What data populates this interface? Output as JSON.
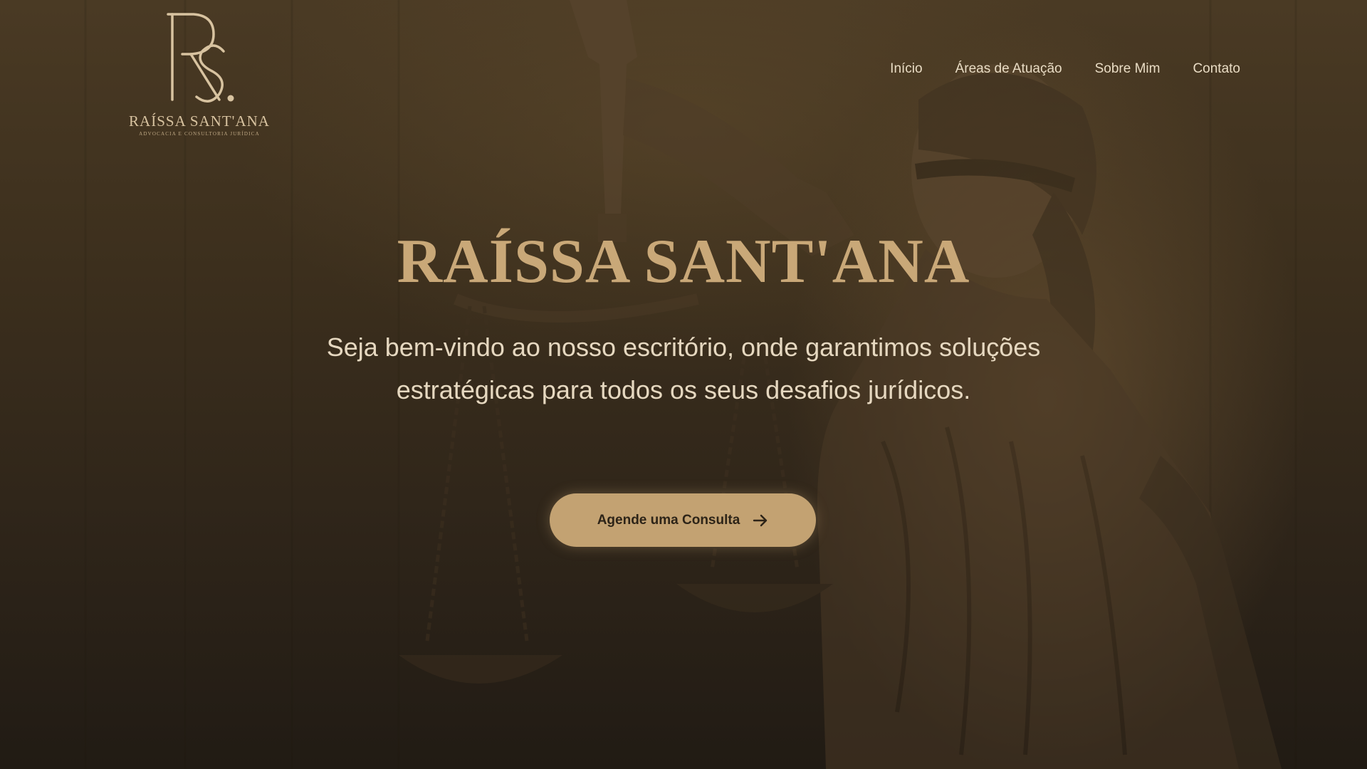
{
  "brand": {
    "logo_monogram": "RS.",
    "name": "RAÍSSA SANT'ANA",
    "tagline": "ADVOCACIA E CONSULTORIA JURÍDICA"
  },
  "nav": {
    "items": [
      {
        "label": "Início"
      },
      {
        "label": "Áreas de Atuação"
      },
      {
        "label": "Sobre Mim"
      },
      {
        "label": "Contato"
      }
    ]
  },
  "hero": {
    "title": "RAÍSSA SANT'ANA",
    "subtitle": "Seja bem-vindo ao nosso escritório, onde garantimos soluções estratégicas para todos os seus desafios jurídicos.",
    "cta_label": "Agende uma Consulta",
    "cta_icon": "arrow-right-icon",
    "background_image": "lady-justice-statue"
  },
  "colors": {
    "gold": "#c9a878",
    "button": "#c3a272",
    "text_light": "#e6d8c0",
    "background": "#3a2d1c"
  }
}
